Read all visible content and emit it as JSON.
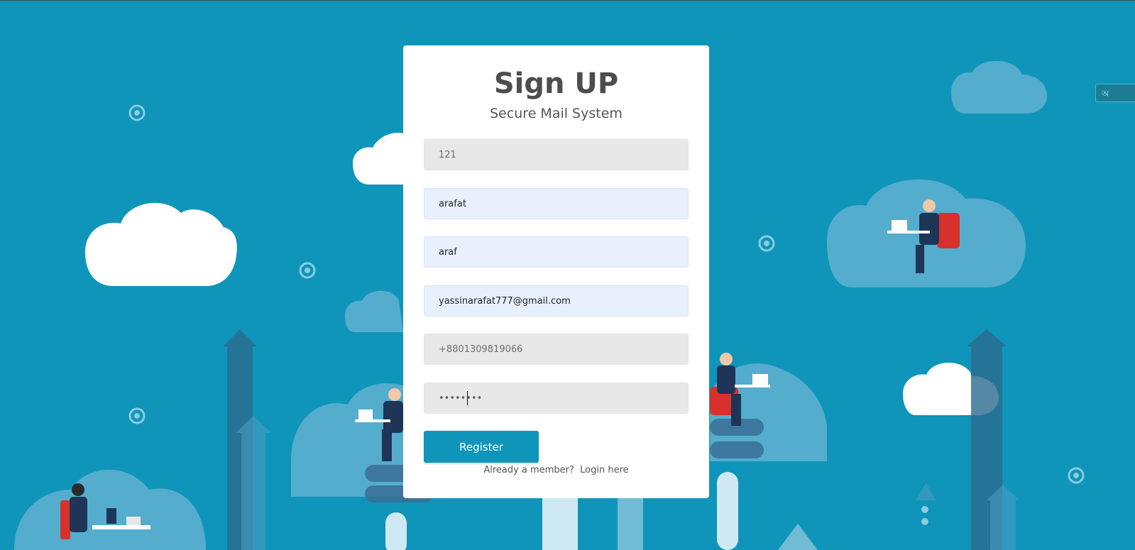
{
  "form": {
    "title": "Sign UP",
    "subtitle": "Secure Mail System",
    "id_placeholder": "121",
    "first_name_value": "arafat",
    "last_name_value": "araf",
    "email_value": "yassinarafat777@gmail.com",
    "phone_placeholder": "+8801309819066",
    "password_value": "abcdefgh",
    "register_label": "Register",
    "member_prompt": "Already a member?",
    "login_link": "Login here"
  },
  "side_widget": {
    "label": "অ"
  },
  "colors": {
    "background": "#0f95ba",
    "accent": "#0f95ba",
    "field_gray": "#e8e8e8",
    "field_autofill": "#e8f0fe",
    "text_dark": "#4d4d4d"
  }
}
